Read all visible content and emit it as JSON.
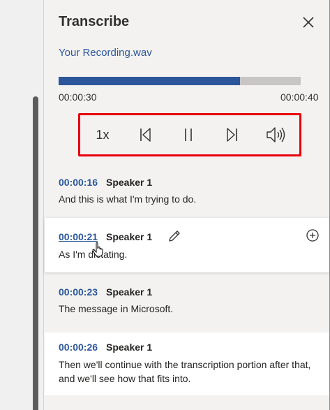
{
  "panel": {
    "title": "Transcribe",
    "close_icon": "close-icon",
    "filename": "Your Recording.wav"
  },
  "playback": {
    "progress_fraction": 0.75,
    "current_time": "00:00:30",
    "total_time": "00:00:40",
    "accent_color": "#2b579a"
  },
  "controls": {
    "speed_label": "1x",
    "icons": [
      "previous-icon",
      "pause-icon",
      "next-icon",
      "volume-icon"
    ],
    "highlight_color": "#e8000b"
  },
  "transcript": [
    {
      "timestamp": "00:00:16",
      "speaker": "Speaker 1",
      "text": "And this is what I'm trying to do."
    },
    {
      "timestamp": "00:00:21",
      "speaker": "Speaker 1",
      "text": "As I'm dictating."
    },
    {
      "timestamp": "00:00:23",
      "speaker": "Speaker 1",
      "text": "The message in Microsoft."
    },
    {
      "timestamp": "00:00:26",
      "speaker": "Speaker 1",
      "text": "Then we'll continue with the transcription portion after that, and we'll see how that fits into."
    }
  ]
}
